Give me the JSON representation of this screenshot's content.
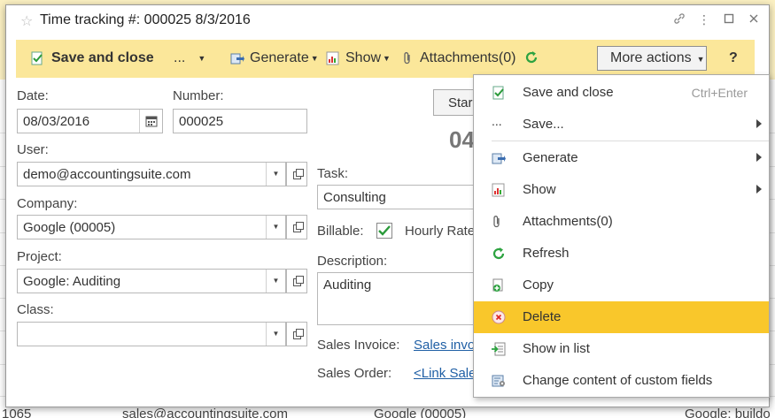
{
  "window": {
    "title": "Time tracking #: 000025 8/3/2016"
  },
  "toolbar": {
    "save_close": "Save and close",
    "more_dots": "...",
    "generate": "Generate",
    "show": "Show",
    "attachments": "Attachments(0)",
    "more_actions": "More actions",
    "help": "?"
  },
  "form": {
    "date_label": "Date:",
    "date_value": "08/03/2016",
    "number_label": "Number:",
    "number_value": "000025",
    "user_label": "User:",
    "user_value": "demo@accountingsuite.com",
    "company_label": "Company:",
    "company_value": "Google (00005)",
    "project_label": "Project:",
    "project_value": "Google: Auditing",
    "class_label": "Class:",
    "class_value": "",
    "task_label": "Task:",
    "task_value": "Consulting",
    "billable_label": "Billable:",
    "hourly_rate_label": "Hourly Rate",
    "description_label": "Description:",
    "description_value": "Auditing",
    "sales_invoice_label": "Sales Invoice:",
    "sales_invoice_link": "Sales invo",
    "sales_order_label": "Sales Order:",
    "sales_order_link": "<Link Sale",
    "start_button": "Star",
    "timer_partial": "04"
  },
  "menu": {
    "items": [
      {
        "label": "Save and close",
        "shortcut": "Ctrl+Enter"
      },
      {
        "label": "Save..."
      },
      {
        "label": "Generate"
      },
      {
        "label": "Show"
      },
      {
        "label": "Attachments(0)"
      },
      {
        "label": "Refresh"
      },
      {
        "label": "Copy"
      },
      {
        "label": "Delete"
      },
      {
        "label": "Show in list"
      },
      {
        "label": "Change content of custom fields"
      }
    ]
  },
  "background": {
    "row_number": "1065",
    "row_email": "sales@accountingsuite.com",
    "row_company": "Google (00005)",
    "row_project": "Google: buildo"
  },
  "colors": {
    "toolbar_bg": "#fbe79a",
    "active_item": "#f9c72b",
    "link": "#1f5fa5"
  }
}
